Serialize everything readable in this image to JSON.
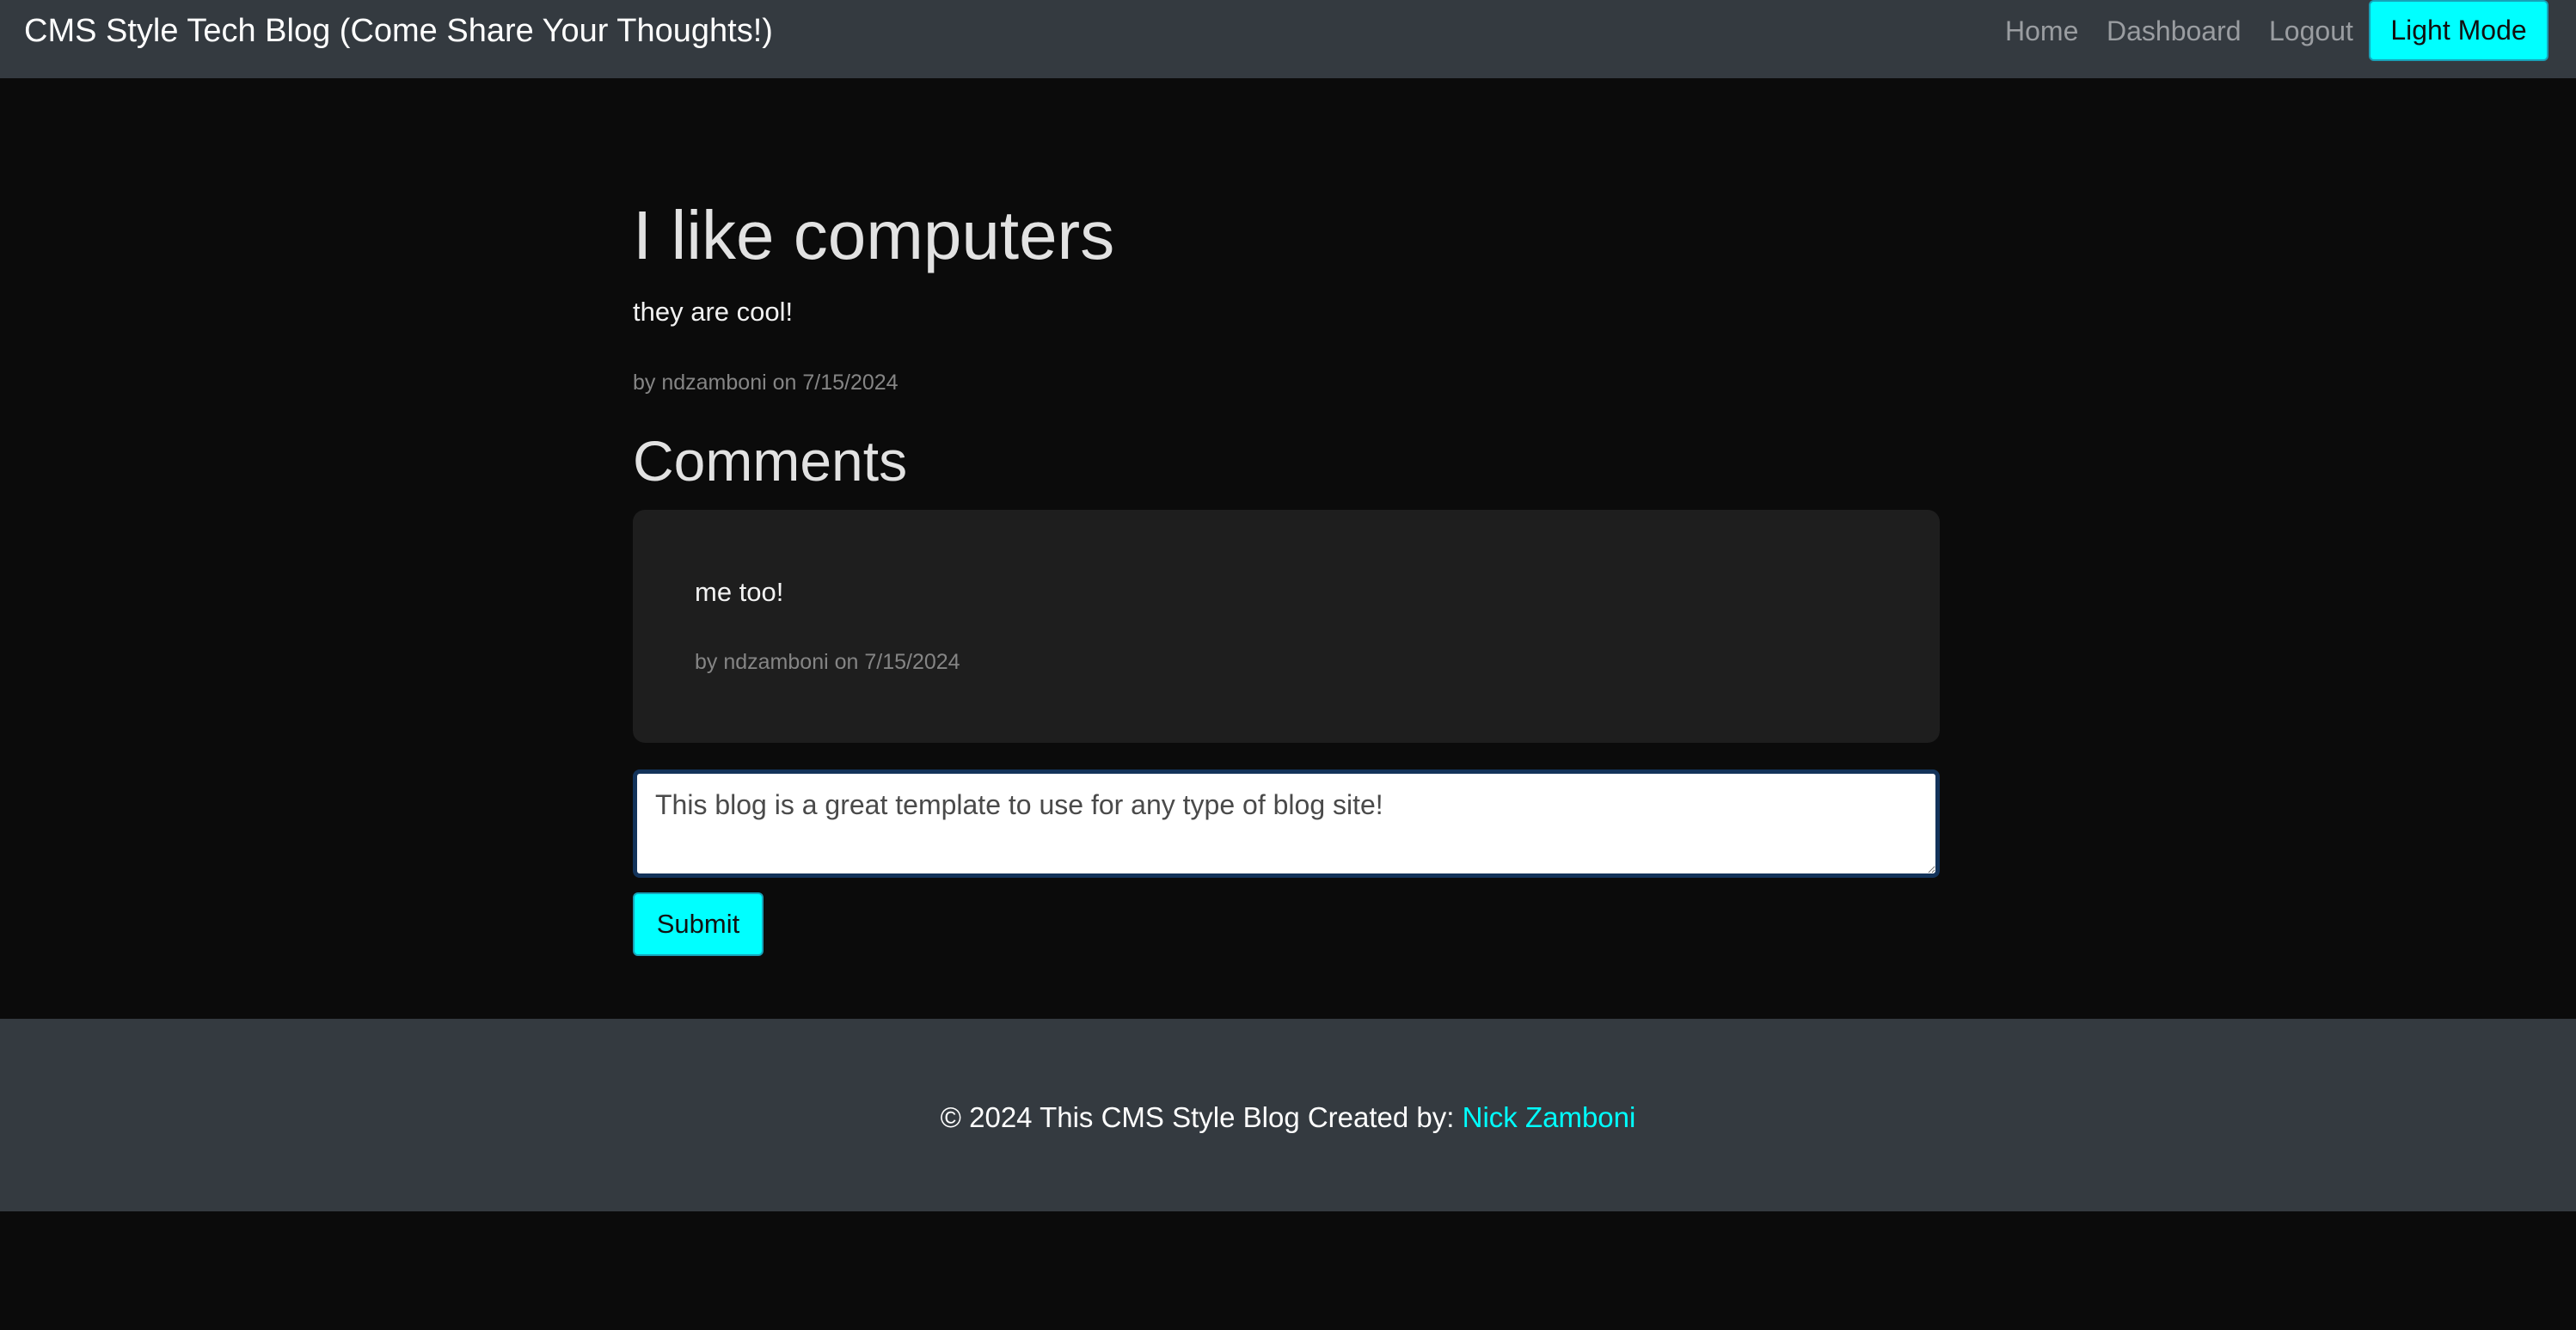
{
  "navbar": {
    "brand": "CMS Style Tech Blog (Come Share Your Thoughts!)",
    "links": {
      "home": "Home",
      "dashboard": "Dashboard",
      "logout": "Logout"
    },
    "mode_toggle": "Light Mode"
  },
  "post": {
    "title": "I like computers",
    "body": "they are cool!",
    "meta": "by ndzamboni on 7/15/2024"
  },
  "comments": {
    "heading": "Comments",
    "items": [
      {
        "text": "me too!",
        "meta": "by ndzamboni on 7/15/2024"
      }
    ],
    "form": {
      "input_value": "This blog is a great template to use for any type of blog site!",
      "submit_label": "Submit"
    }
  },
  "footer": {
    "prefix": "© 2024 This CMS Style Blog Created by:",
    "author_link": "Nick Zamboni"
  },
  "colors": {
    "accent": "#00ffff",
    "page_background": "#0b0b0b",
    "bar_background": "#343a40",
    "card_background": "#1e1e1e"
  }
}
